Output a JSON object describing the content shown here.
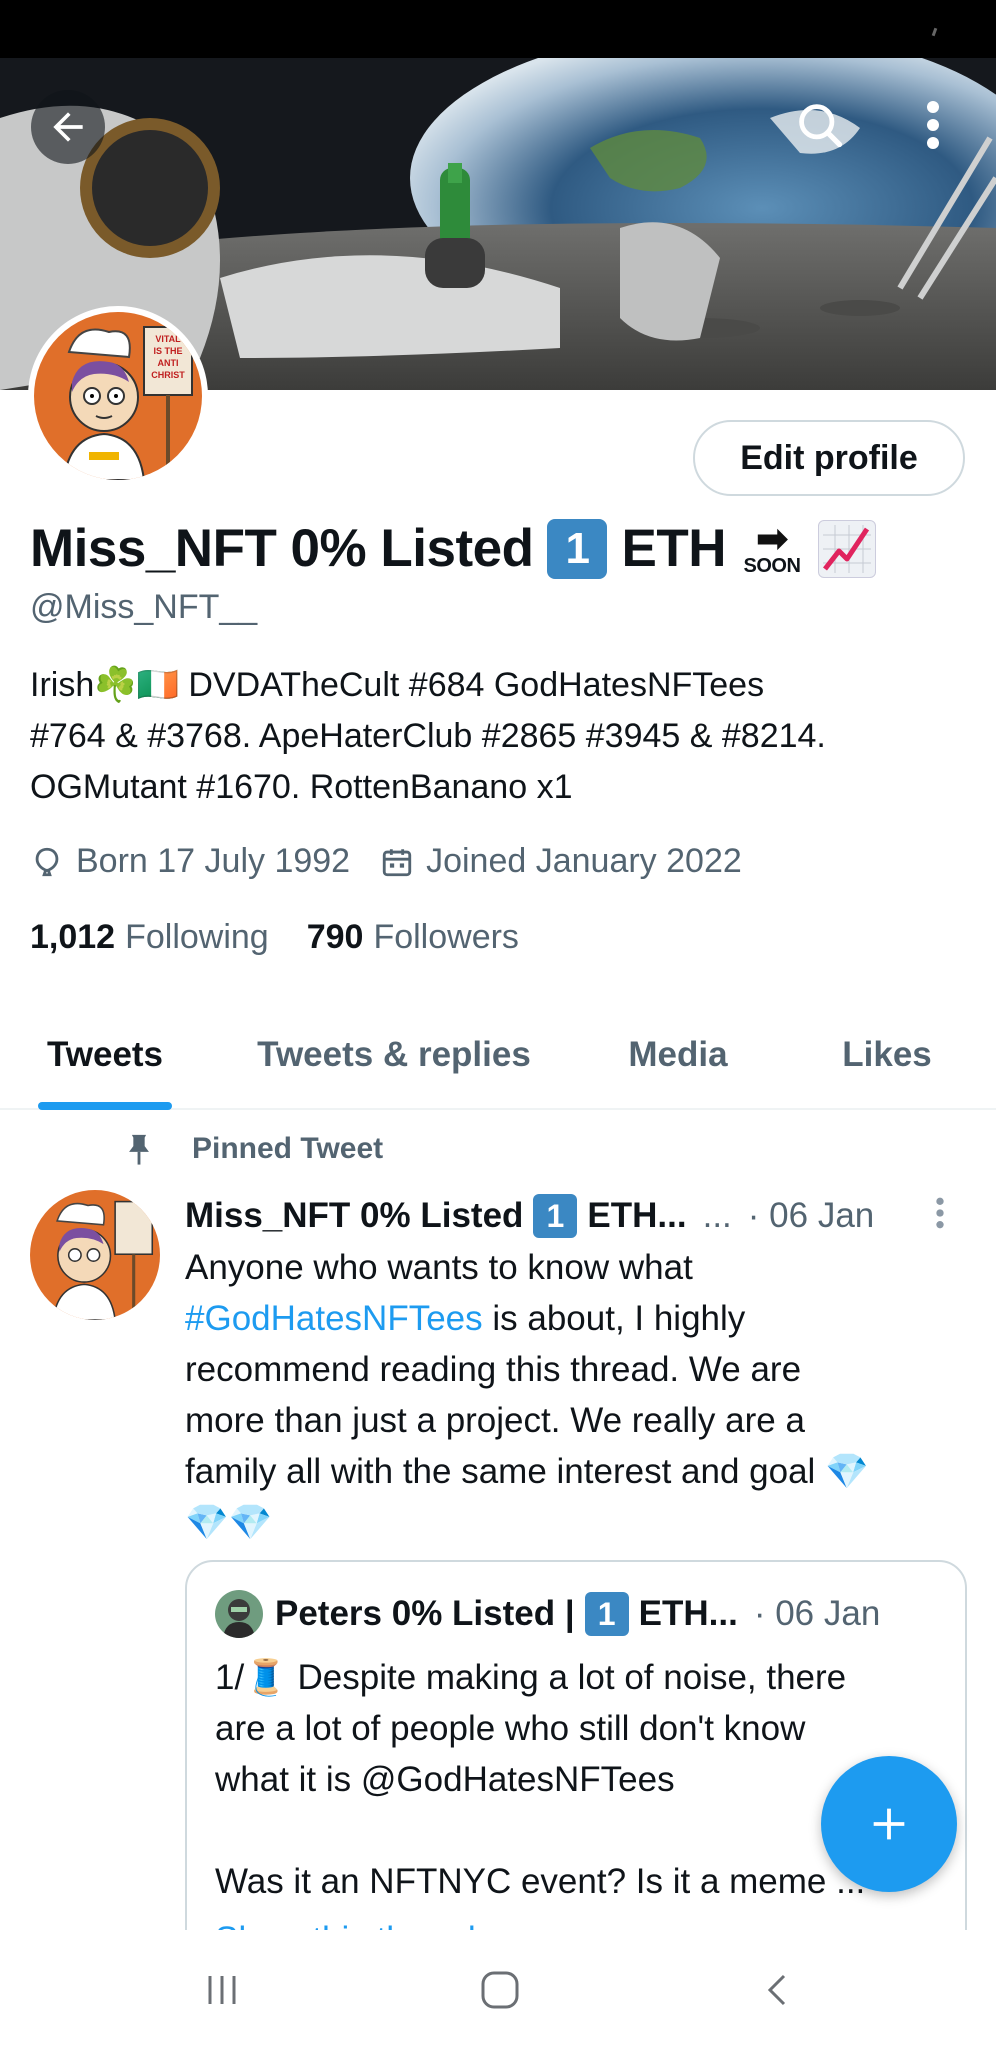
{
  "profile": {
    "display_name_prefix": "Miss_NFT 0% Listed",
    "keycap_one": "1",
    "display_name_eth": "ETH",
    "soon_label": "SOON",
    "handle": "@Miss_NFT__",
    "edit_profile_label": "Edit profile",
    "bio_lines": [
      "Irish☘️🇮🇪  DVDATheCult #684 GodHatesNFTees",
      "#764 & #3768. ApeHaterClub #2865 #3945 & #8214.",
      "OGMutant #1670. RottenBanano x1"
    ],
    "born": "Born 17 July 1992",
    "joined": "Joined January 2022",
    "following_count": "1,012",
    "following_label": "Following",
    "followers_count": "790",
    "followers_label": "Followers",
    "avatar_sign_text": "VITAL IS THE ANTI CHRIST"
  },
  "tabs": [
    {
      "label": "Tweets",
      "active": true
    },
    {
      "label": "Tweets & replies",
      "active": false
    },
    {
      "label": "Media",
      "active": false
    },
    {
      "label": "Likes",
      "active": false
    }
  ],
  "pinned_tweet": {
    "pinned_label": "Pinned Tweet",
    "author_prefix": "Miss_NFT 0% Listed",
    "author_keycap": "1",
    "author_suffix": "ETH...",
    "ellipsis": "...",
    "date": "· 06 Jan",
    "text_line1": "Anyone who wants to know what",
    "hashtag": "#GodHatesNFTees",
    "text_line2_rest": " is about, I highly",
    "text_line3": "recommend reading this thread. We are",
    "text_line4": "more than just a project. We really are a",
    "text_line5": "family all with the same interest and goal 💎",
    "text_line6": "💎💎"
  },
  "quoted_tweet": {
    "author_prefix": "Peters 0% Listed |",
    "author_keycap": "1",
    "author_suffix": "ETH...",
    "date": "· 06 Jan",
    "line1": "1/🧵 Despite making a lot of noise, there",
    "line2": "are a lot of people who still don't know",
    "line3": "what it is @GodHatesNFTees",
    "line4": "",
    "line5": "Was it an NFTNYC event? Is it a meme ...",
    "show_thread": "Show this thread"
  },
  "icons": {
    "back": "arrow-left-icon",
    "search": "search-icon",
    "more": "more-vertical-icon",
    "birthday": "balloon-icon",
    "calendar": "calendar-icon",
    "pin": "pin-icon",
    "compose": "plus-icon"
  },
  "colors": {
    "accent": "#1d9bf0",
    "secondary_text": "#536471",
    "keycap": "#3b88c3"
  }
}
